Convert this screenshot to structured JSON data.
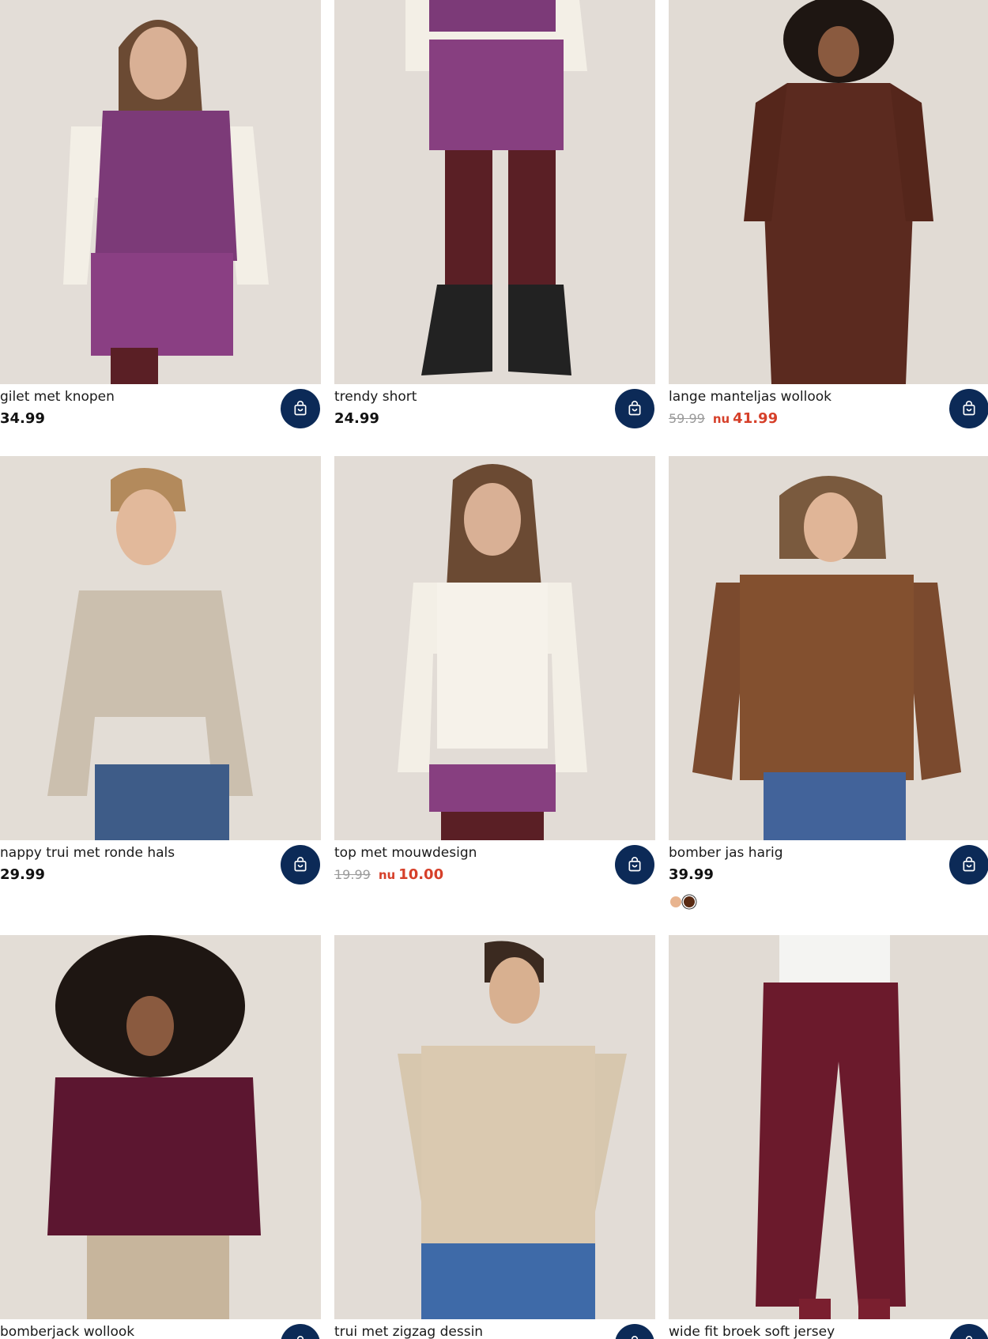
{
  "products": [
    {
      "title": "gilet met knopen",
      "price": "34.99"
    },
    {
      "title": "trendy short",
      "price": "24.99"
    },
    {
      "title": "lange manteljas wollook",
      "old_price": "59.99",
      "now_label": "nu",
      "sale_price": "41.99"
    },
    {
      "title": "nappy trui met ronde hals",
      "price": "29.99"
    },
    {
      "title": "top met mouwdesign",
      "old_price": "19.99",
      "now_label": "nu",
      "sale_price": "10.00"
    },
    {
      "title": "bomber jas harig",
      "price": "39.99",
      "swatches": [
        "#e8b48f",
        "#5a2a12"
      ]
    },
    {
      "title": "bomberjack wollook"
    },
    {
      "title": "trui met zigzag dessin"
    },
    {
      "title": "wide fit broek soft jersey"
    }
  ],
  "colors": {
    "cart_button": "#0c2a57",
    "sale": "#d6402a",
    "photo_bg": "#e4dfd9"
  },
  "icons": {
    "cart": "shopping-bag-icon"
  }
}
